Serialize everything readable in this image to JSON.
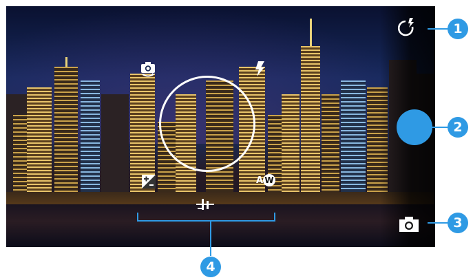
{
  "controls": {
    "flash_mode_icon": "flash-auto-icon",
    "switch_camera_icon": "switch-camera-icon",
    "flash_icon": "flash-icon",
    "exposure_icon": "exposure-icon",
    "white_balance_icon": "white-balance-auto-icon",
    "white_balance_label": "W",
    "adjust_icon": "adjust-sliders-icon",
    "shutter_icon": "shutter-button",
    "camera_mode_icon": "camera-icon"
  },
  "callouts": {
    "one": "1",
    "two": "2",
    "three": "3",
    "four": "4"
  },
  "colors": {
    "accent": "#2f9ae4",
    "overlay": "#ffffff"
  }
}
